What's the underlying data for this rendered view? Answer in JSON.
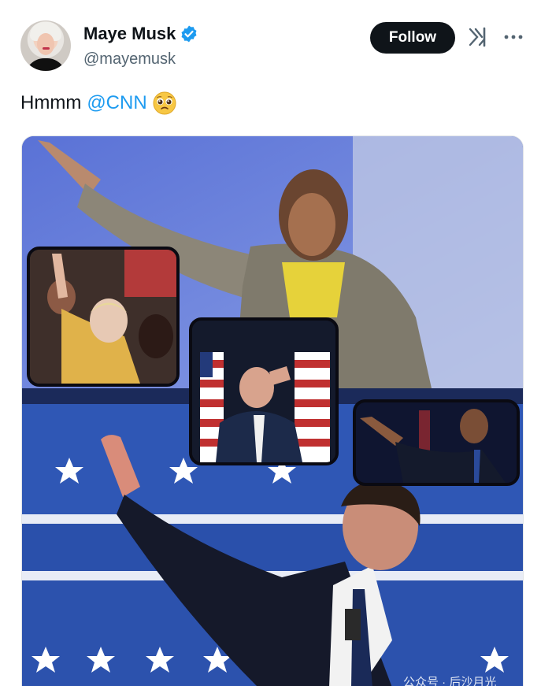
{
  "post": {
    "author": {
      "display_name": "Maye Musk",
      "handle": "@mayemusk",
      "verified": true,
      "avatar_icon": "avatar-photo"
    },
    "actions": {
      "follow_label": "Follow",
      "grok_icon": "grok-icon",
      "more_icon": "more-icon"
    },
    "text": {
      "prefix": "Hmmm",
      "mention": "@CNN",
      "emoji": "pleading-face-emoji"
    },
    "media": {
      "watermark": "公众号 · 后沙月光"
    }
  },
  "colors": {
    "accent": "#1d9bf0",
    "follow_bg": "#0f1419",
    "handle": "#536471"
  }
}
